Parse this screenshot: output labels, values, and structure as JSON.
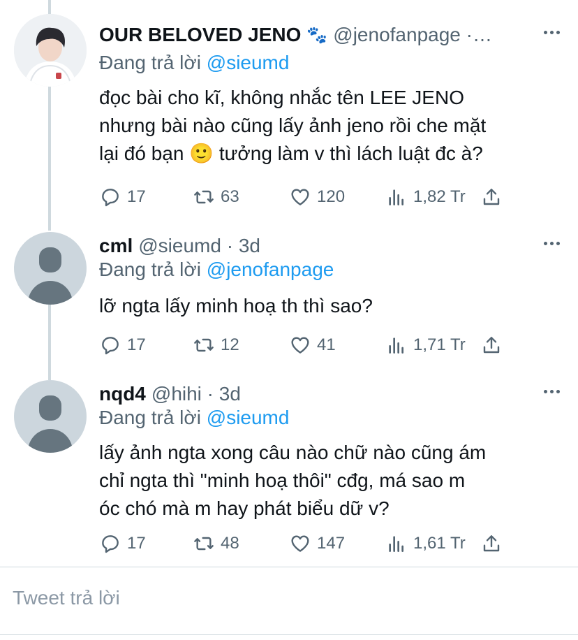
{
  "tweets": [
    {
      "name": "OUR BELOVED JENO",
      "name_emoji": "🐾",
      "handle": "@jenofanpage ·…",
      "reply_prefix": "Đang trả lời",
      "reply_to": "@sieumd",
      "text_lines": [
        "đọc bài cho kĩ, không nhắc tên LEE JENO",
        "nhưng bài nào cũng lấy ảnh jeno rồi che mặt",
        "lại đó bạn 🙂  tưởng làm v thì lách luật đc à?"
      ],
      "replies": "17",
      "retweets": "63",
      "likes": "120",
      "views": "1,82 Tr"
    },
    {
      "name": "cml",
      "handle": "@sieumd · 3d",
      "reply_prefix": "Đang trả lời",
      "reply_to": "@jenofanpage",
      "text_lines": [
        "lỡ ngta lấy minh hoạ th thì sao?"
      ],
      "replies": "17",
      "retweets": "12",
      "likes": "41",
      "views": "1,71 Tr"
    },
    {
      "name": "nqd4",
      "handle": "@hihi · 3d",
      "reply_prefix": "Đang trả lời",
      "reply_to": "@sieumd",
      "text_lines": [
        "lấy ảnh ngta xong câu nào chữ nào cũng ám",
        "chỉ ngta thì \"minh hoạ thôi\" cđg, má sao m",
        "óc chó mà m hay phát biểu dữ v?"
      ],
      "replies": "17",
      "retweets": "48",
      "likes": "147",
      "views": "1,61 Tr"
    }
  ],
  "compose": {
    "placeholder": "Tweet trả lời"
  },
  "colors": {
    "accent": "#1d9bf0",
    "secondary_text": "#536471",
    "divider": "#cfd9de"
  }
}
